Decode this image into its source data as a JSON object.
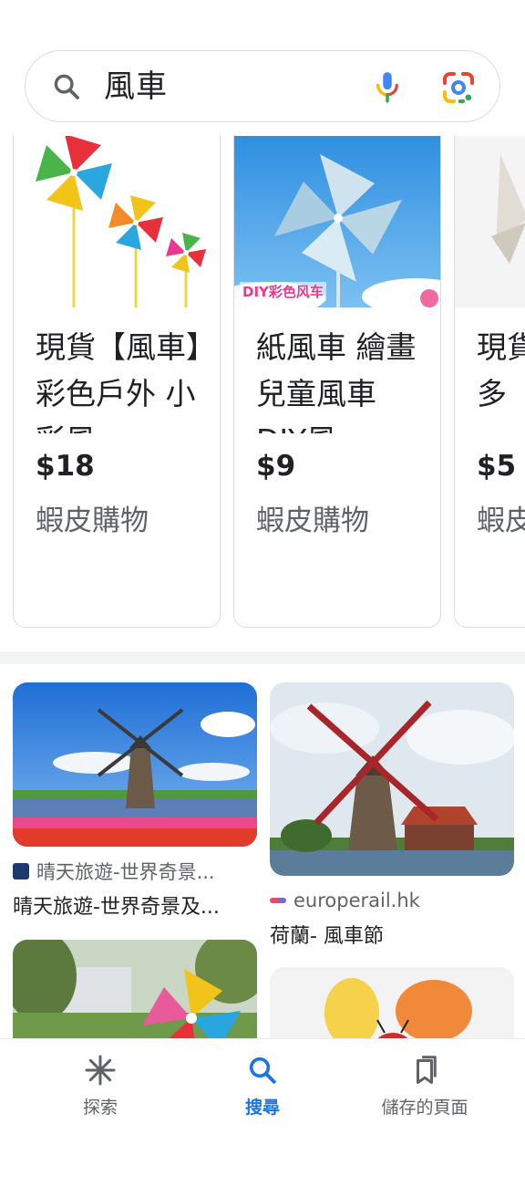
{
  "search": {
    "query": "風車",
    "icons": [
      "search-icon",
      "mic-icon",
      "google-lens-icon"
    ]
  },
  "shopping": {
    "products": [
      {
        "title": "現貨【風車】彩色戶外 小彩風",
        "price": "$18",
        "store": "蝦皮購物"
      },
      {
        "title": "紙風車 繪畫 兒童風車 DIY風",
        "price": "$9",
        "store": "蝦皮購物",
        "image_caption": "DIY彩色风车"
      },
      {
        "title": "現貨【風車】多",
        "price": "$5",
        "store": "蝦皮購物"
      }
    ]
  },
  "image_results": [
    {
      "source": "晴天旅遊-世界奇景...",
      "title": "晴天旅遊-世界奇景及..."
    },
    {
      "source": "europerail.hk",
      "title": "荷蘭- 風車節"
    },
    {
      "source": "",
      "title": ""
    },
    {
      "source": "",
      "title": ""
    }
  ],
  "bottom_nav": {
    "items": [
      {
        "label": "探索",
        "icon": "asterisk-icon",
        "active": false
      },
      {
        "label": "搜尋",
        "icon": "search-icon",
        "active": true
      },
      {
        "label": "儲存的頁面",
        "icon": "bookmarks-icon",
        "active": false
      }
    ]
  },
  "colors": {
    "accent_blue": "#1a73e8",
    "text_primary": "#202124",
    "text_secondary": "#5f6368",
    "border": "#dadce0"
  }
}
